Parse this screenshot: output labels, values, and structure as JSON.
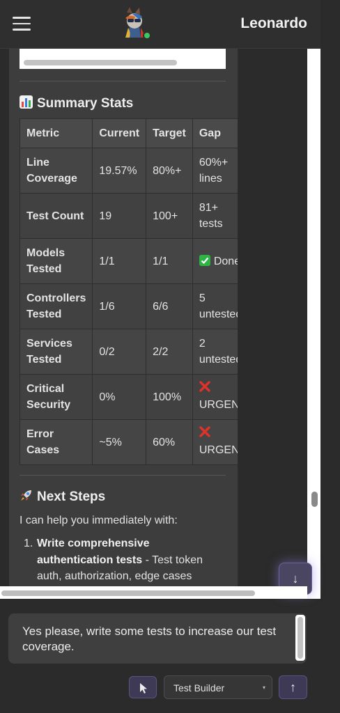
{
  "header": {
    "app_name": "Leonardo",
    "menu_icon": "hamburger-menu-icon",
    "avatar_icon": "llama-avatar-icon",
    "status_color": "#3cc760"
  },
  "summary": {
    "icon": "bar-chart-icon",
    "title": "Summary Stats",
    "columns": [
      "Metric",
      "Current",
      "Target",
      "Gap"
    ],
    "rows": [
      {
        "metric": [
          "Line",
          "Coverage"
        ],
        "current": "19.57%",
        "target": "80%+",
        "gap": [
          "60%+",
          "lines"
        ]
      },
      {
        "metric": [
          "Test Count"
        ],
        "current": "19",
        "target": "100+",
        "gap": [
          "81+",
          "tests"
        ]
      },
      {
        "metric": [
          "Models",
          "Tested"
        ],
        "current": "1/1",
        "target": "1/1",
        "gap_icon": "check-icon",
        "gap": [
          "Done"
        ]
      },
      {
        "metric": [
          "Controllers",
          "Tested"
        ],
        "current": "1/6",
        "target": "6/6",
        "gap": [
          "5",
          "untested"
        ]
      },
      {
        "metric": [
          "Services",
          "Tested"
        ],
        "current": "0/2",
        "target": "2/2",
        "gap": [
          "2",
          "untested"
        ]
      },
      {
        "metric": [
          "Critical",
          "Security"
        ],
        "current": "0%",
        "target": "100%",
        "gap_icon": "cross-icon",
        "gap": [
          "URGENT"
        ]
      },
      {
        "metric": [
          "Error",
          "Cases"
        ],
        "current": "~5%",
        "target": "60%",
        "gap_icon": "cross-icon",
        "gap": [
          "URGENT"
        ]
      }
    ]
  },
  "next_steps": {
    "icon": "rocket-icon",
    "title": "Next Steps",
    "intro": "I can help you immediately with:",
    "items": [
      {
        "number": "1.",
        "bold": "Write comprehensive authentication tests",
        "text": " - Test token auth, authorization, edge cases"
      }
    ]
  },
  "composer": {
    "input_value": "Yes please, write some tests to increase our test coverage.",
    "pointer_icon": "cursor-arrow-icon",
    "mode_value": "Test Builder",
    "mode_caret": "▾",
    "send_icon": "arrow-up-icon",
    "send_glyph": "↑",
    "scroll_down_icon": "arrow-down-icon",
    "scroll_down_glyph": "↓"
  },
  "colors": {
    "accent": "#6a63a0",
    "check": "#2fb344",
    "cross": "#e0312b"
  }
}
